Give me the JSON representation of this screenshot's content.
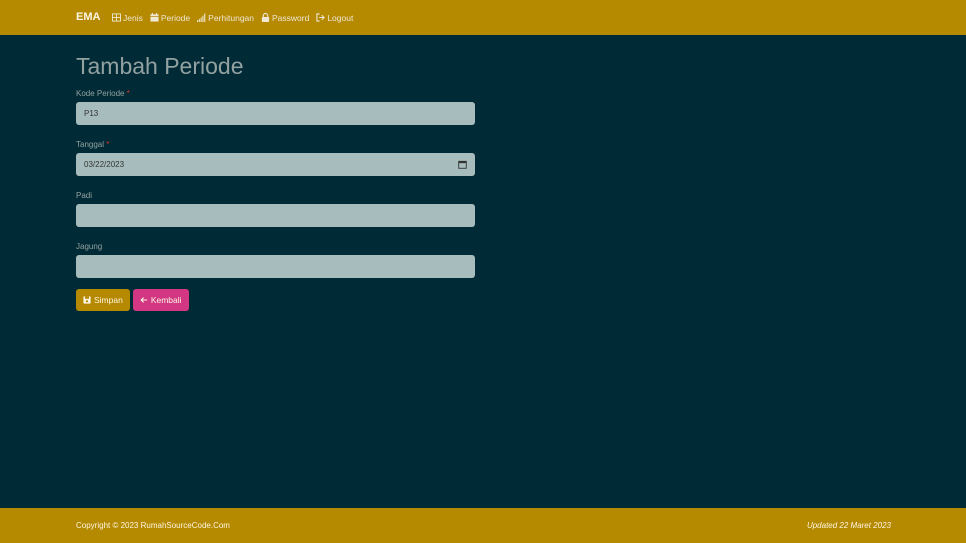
{
  "navbar": {
    "brand": "EMA",
    "items": [
      {
        "label": "Jenis",
        "icon": "table-icon"
      },
      {
        "label": "Periode",
        "icon": "calendar-icon"
      },
      {
        "label": "Perhitungan",
        "icon": "signal-icon"
      },
      {
        "label": "Password",
        "icon": "lock-icon"
      },
      {
        "label": "Logout",
        "icon": "logout-icon"
      }
    ]
  },
  "form": {
    "title": "Tambah Periode",
    "fields": [
      {
        "label": "Kode Periode",
        "required": "*",
        "value": "P13"
      },
      {
        "label": "Tanggal",
        "required": "*",
        "value": "03/22/2023"
      },
      {
        "label": "Padi",
        "required": "",
        "value": ""
      },
      {
        "label": "Jagung",
        "required": "",
        "value": ""
      }
    ],
    "save_label": "Simpan",
    "back_label": "Kembali"
  },
  "footer": {
    "copyright": "Copyright © 2023 RumahSourceCode.Com",
    "updated": "Updated 22 Maret 2023"
  },
  "colors": {
    "background": "#002b36",
    "navbar": "#b58900",
    "input": "#a7bcbc",
    "save_button": "#b58900",
    "back_button": "#d33682"
  }
}
